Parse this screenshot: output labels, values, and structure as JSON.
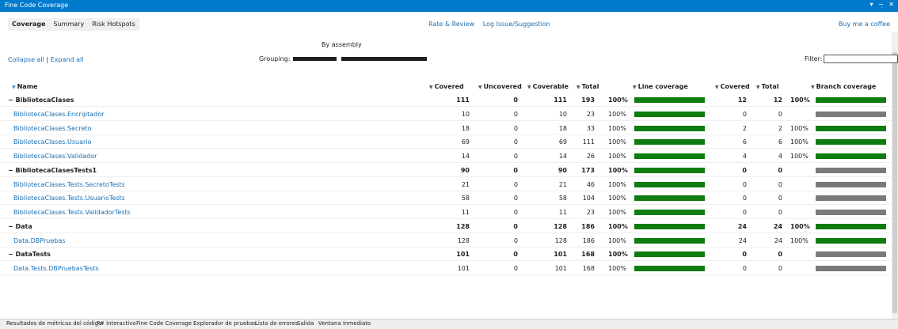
{
  "window": {
    "title": "Fine Code Coverage",
    "controls": "▾ −̣ ✕"
  },
  "tabs": [
    "Coverage",
    "Summary",
    "Risk Hotspots"
  ],
  "links": {
    "rate": "Rate & Review",
    "log": "Log Issue/Suggestion",
    "coffee": "Buy me a coffee"
  },
  "report": {
    "title": "By assembly",
    "collapse_all": "Collapse all",
    "separator": "|",
    "expand_all": "Expand all",
    "grouping_label": "Grouping:",
    "filter_label": "Filter:"
  },
  "headers": {
    "name": "Name",
    "covered": "Covered",
    "uncovered": "Uncovered",
    "coverable": "Coverable",
    "total": "Total",
    "line_coverage": "Line coverage",
    "b_covered": "Covered",
    "b_total": "Total",
    "branch_coverage": "Branch coverage"
  },
  "rows": [
    {
      "name": "−  BibliotecaClases",
      "group": true,
      "covered": "111",
      "uncovered": "0",
      "coverable": "111",
      "total": "193",
      "pct": "100%",
      "line": 1.0,
      "bcov": "12",
      "btot": "12",
      "bpct": "100%",
      "branch": 1.0
    },
    {
      "name": "BibliotecaClases.Encriptador",
      "group": false,
      "covered": "10",
      "uncovered": "0",
      "coverable": "10",
      "total": "23",
      "pct": "100%",
      "line": 1.0,
      "bcov": "0",
      "btot": "0",
      "bpct": "",
      "branch": null
    },
    {
      "name": "BibliotecaClases.Secreto",
      "group": false,
      "covered": "18",
      "uncovered": "0",
      "coverable": "18",
      "total": "33",
      "pct": "100%",
      "line": 1.0,
      "bcov": "2",
      "btot": "2",
      "bpct": "100%",
      "branch": 1.0
    },
    {
      "name": "BibliotecaClases.Usuario",
      "group": false,
      "covered": "69",
      "uncovered": "0",
      "coverable": "69",
      "total": "111",
      "pct": "100%",
      "line": 1.0,
      "bcov": "6",
      "btot": "6",
      "bpct": "100%",
      "branch": 1.0
    },
    {
      "name": "BibliotecaClases.Validador",
      "group": false,
      "covered": "14",
      "uncovered": "0",
      "coverable": "14",
      "total": "26",
      "pct": "100%",
      "line": 1.0,
      "bcov": "4",
      "btot": "4",
      "bpct": "100%",
      "branch": 1.0
    },
    {
      "name": "−  BibliotecaClasesTests1",
      "group": true,
      "covered": "90",
      "uncovered": "0",
      "coverable": "90",
      "total": "173",
      "pct": "100%",
      "line": 1.0,
      "bcov": "0",
      "btot": "0",
      "bpct": "",
      "branch": null
    },
    {
      "name": "BibliotecaClases.Tests.SecretoTests",
      "group": false,
      "covered": "21",
      "uncovered": "0",
      "coverable": "21",
      "total": "46",
      "pct": "100%",
      "line": 1.0,
      "bcov": "0",
      "btot": "0",
      "bpct": "",
      "branch": null
    },
    {
      "name": "BibliotecaClases.Tests.UsuarioTests",
      "group": false,
      "covered": "58",
      "uncovered": "0",
      "coverable": "58",
      "total": "104",
      "pct": "100%",
      "line": 1.0,
      "bcov": "0",
      "btot": "0",
      "bpct": "",
      "branch": null
    },
    {
      "name": "BibliotecaClases.Tests.ValidadorTests",
      "group": false,
      "covered": "11",
      "uncovered": "0",
      "coverable": "11",
      "total": "23",
      "pct": "100%",
      "line": 1.0,
      "bcov": "0",
      "btot": "0",
      "bpct": "",
      "branch": null
    },
    {
      "name": "−  Data",
      "group": true,
      "covered": "128",
      "uncovered": "0",
      "coverable": "128",
      "total": "186",
      "pct": "100%",
      "line": 1.0,
      "bcov": "24",
      "btot": "24",
      "bpct": "100%",
      "branch": 1.0
    },
    {
      "name": "Data.DBPruebas",
      "group": false,
      "covered": "128",
      "uncovered": "0",
      "coverable": "128",
      "total": "186",
      "pct": "100%",
      "line": 1.0,
      "bcov": "24",
      "btot": "24",
      "bpct": "100%",
      "branch": 1.0
    },
    {
      "name": "−  DataTests",
      "group": true,
      "covered": "101",
      "uncovered": "0",
      "coverable": "101",
      "total": "168",
      "pct": "100%",
      "line": 1.0,
      "bcov": "0",
      "btot": "0",
      "bpct": "",
      "branch": null
    },
    {
      "name": "Data.Tests.DBPruebasTests",
      "group": false,
      "covered": "101",
      "uncovered": "0",
      "coverable": "101",
      "total": "168",
      "pct": "100%",
      "line": 1.0,
      "bcov": "0",
      "btot": "0",
      "bpct": "",
      "branch": null
    }
  ],
  "bottom_tabs": [
    "Resultados de métricas del código",
    "F# interactivo",
    "Fine Code Coverage",
    "Explorador de pruebas",
    "Lista de errores",
    "Salida",
    "Ventana Inmediato"
  ],
  "colors": {
    "accent": "#007acc",
    "covered_bar": "#107c10",
    "no_branch_bar": "#7a7a7a",
    "link": "#1a6fb3"
  }
}
